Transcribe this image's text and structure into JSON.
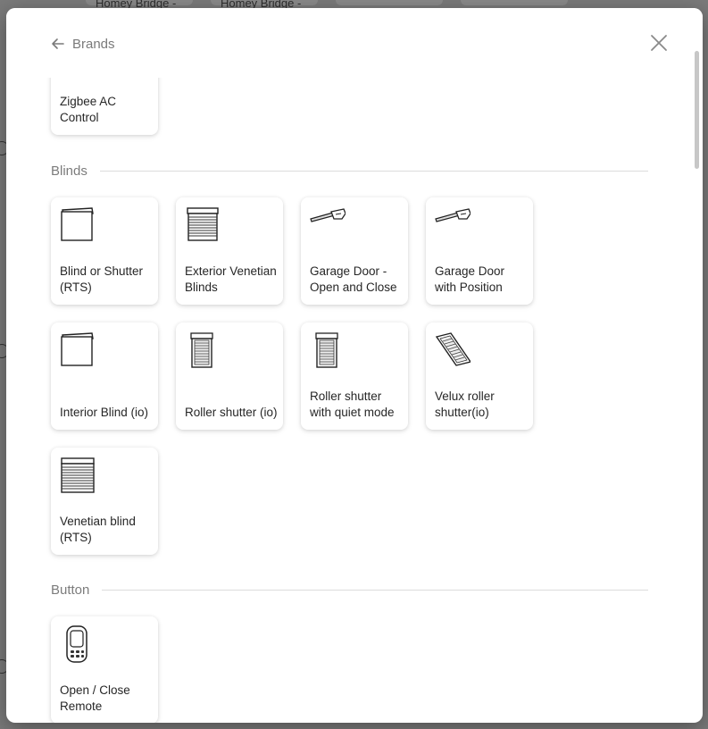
{
  "background": {
    "top_items": [
      "Homey Bridge -",
      "Homey Bridge -"
    ]
  },
  "header": {
    "back_label": "Brands",
    "back_icon": "arrow-left-icon",
    "close_icon": "close-icon"
  },
  "partial_card": {
    "label": "Zigbee AC Control"
  },
  "sections": {
    "blinds": {
      "title": "Blinds",
      "items": [
        {
          "label": "Blind or Shutter (RTS)",
          "icon": "blind-icon"
        },
        {
          "label": "Exterior Venetian Blinds",
          "icon": "venetian-blind-icon"
        },
        {
          "label": "Garage Door - Open and Close",
          "icon": "garage-door-opener-icon"
        },
        {
          "label": "Garage Door with Position",
          "icon": "garage-door-opener-icon"
        },
        {
          "label": "Interior Blind (io)",
          "icon": "blind-icon"
        },
        {
          "label": "Roller shutter (io)",
          "icon": "roller-shutter-icon"
        },
        {
          "label": "Roller shutter with quiet mode",
          "icon": "roller-shutter-icon"
        },
        {
          "label": "Velux roller shutter(io)",
          "icon": "velux-shutter-icon"
        },
        {
          "label": "Venetian blind (RTS)",
          "icon": "venetian-blind-icon"
        }
      ]
    },
    "button": {
      "title": "Button",
      "items": [
        {
          "label": "Open / Close Remote",
          "icon": "remote-icon"
        }
      ]
    }
  }
}
